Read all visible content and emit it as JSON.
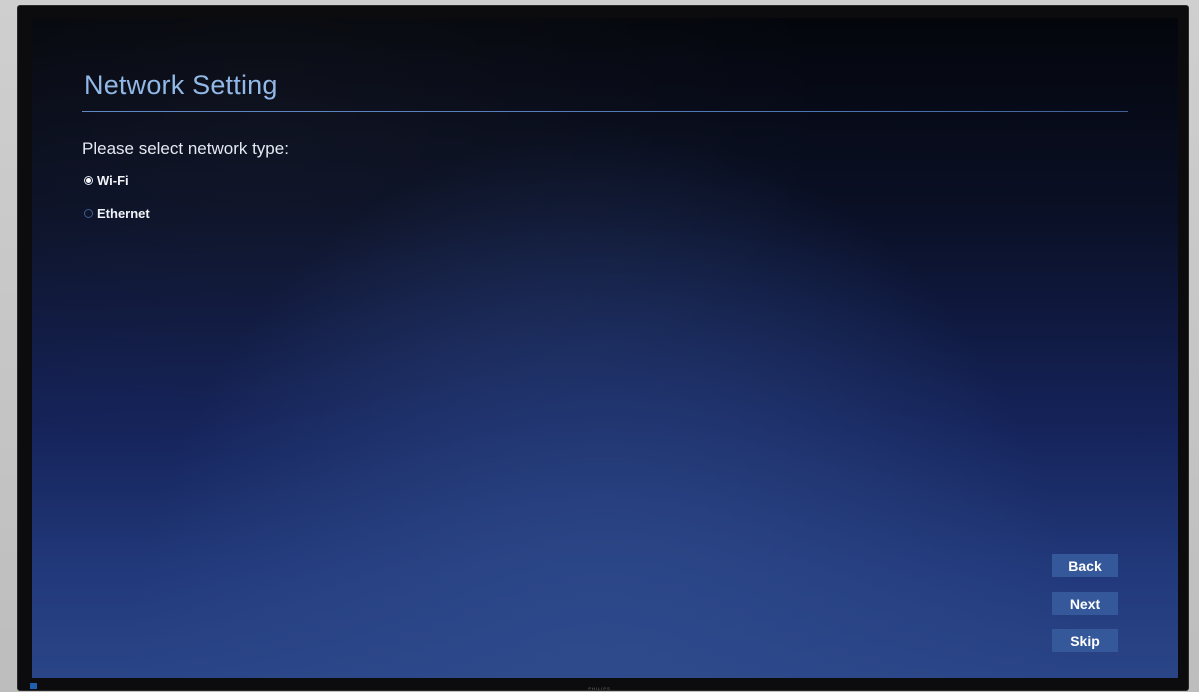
{
  "screen": {
    "title": "Network Setting",
    "prompt": "Please select network type:",
    "options": [
      {
        "label": "Wi-Fi",
        "selected": true
      },
      {
        "label": "Ethernet",
        "selected": false
      }
    ],
    "buttons": {
      "back": "Back",
      "next": "Next",
      "skip": "Skip"
    }
  },
  "monitor": {
    "brand": "PHILIPS"
  },
  "colors": {
    "title": "#8fb6e6",
    "button_bg": "#34589a",
    "background_bottom": "#2a4587"
  }
}
